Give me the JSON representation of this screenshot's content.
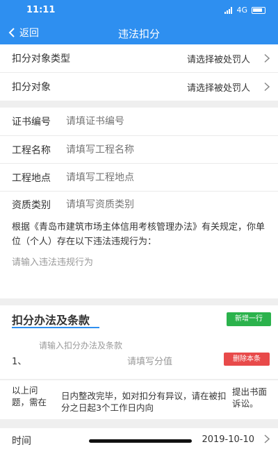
{
  "status": {
    "time": "11:11",
    "network": "4G"
  },
  "navbar": {
    "back_label": "返回",
    "title": "违法扣分"
  },
  "target_type": {
    "label": "扣分对象类型",
    "value": "请选择被处罚人"
  },
  "target": {
    "label": "扣分对象",
    "value": "请选择被处罚人"
  },
  "fields": [
    {
      "label": "证书编号",
      "placeholder": "请填证书编号"
    },
    {
      "label": "工程名称",
      "placeholder": "请填写工程名称"
    },
    {
      "label": "工程地点",
      "placeholder": "请填写工程地点"
    },
    {
      "label": "资质类别",
      "placeholder": "请填写资质类别"
    }
  ],
  "description": {
    "text": "根据《青岛市建筑市场主体信用考核管理办法》有关规定，你单位（个人）存在以下违法违规行为：",
    "violation_placeholder": "请输入违法违规行为"
  },
  "clauses": {
    "title": "扣分办法及条款",
    "add_label": "新增一行",
    "rows": [
      {
        "index": "1、",
        "clause_placeholder": "请输入扣分办法及条款",
        "score_placeholder": "请填写分值",
        "delete_label": "删除本条"
      }
    ]
  },
  "notice": {
    "part1": "以上问题，需在",
    "part2": "日内整改完毕，如对扣分有异议，请在被扣分之日起3个工作日内向",
    "part3": "提出书面诉讼。"
  },
  "time": {
    "label": "时间",
    "value": "2019-10-10"
  }
}
